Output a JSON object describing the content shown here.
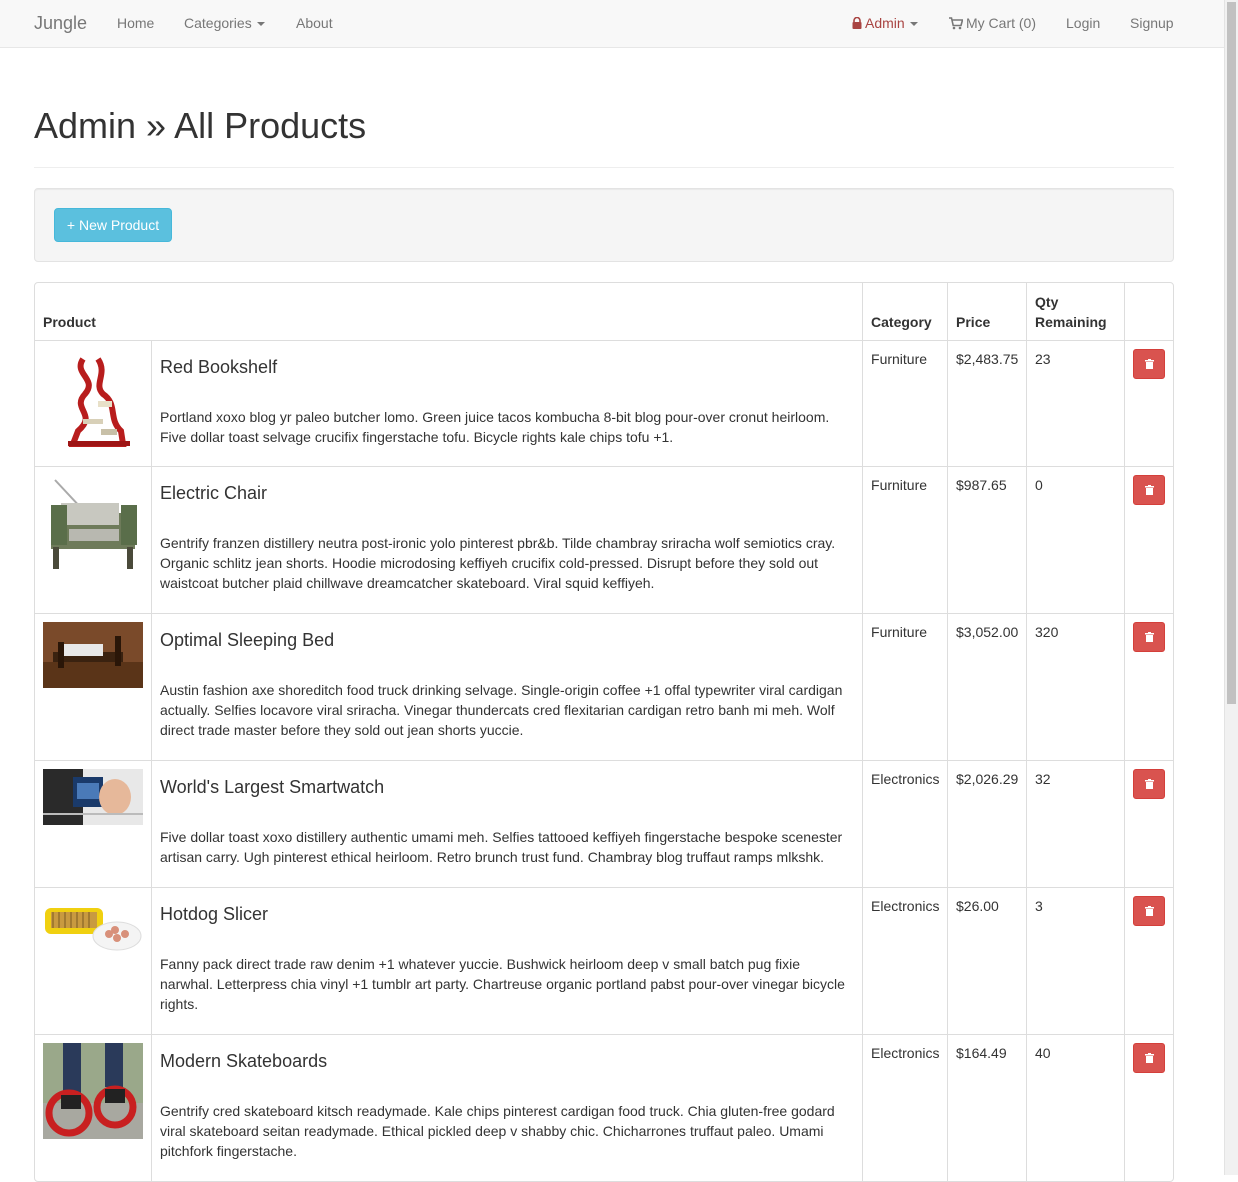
{
  "nav": {
    "brand": "Jungle",
    "home": "Home",
    "categories": "Categories",
    "about": "About",
    "admin": "Admin",
    "cart": "My Cart (0)",
    "login": "Login",
    "signup": "Signup"
  },
  "page": {
    "title": "Admin » All Products",
    "new_product_label": "+ New Product"
  },
  "table": {
    "headers": {
      "product": "Product",
      "category": "Category",
      "price": "Price",
      "qty": "Qty Remaining"
    },
    "rows": [
      {
        "name": "Red Bookshelf",
        "description": "Portland xoxo blog yr paleo butcher lomo. Green juice tacos kombucha 8-bit blog pour-over cronut heirloom. Five dollar toast selvage crucifix fingerstache tofu. Bicycle rights kale chips tofu +1.",
        "category": "Furniture",
        "price": "$2,483.75",
        "qty": "23",
        "image": "red-bookshelf-image"
      },
      {
        "name": "Electric Chair",
        "description": "Gentrify franzen distillery neutra post-ironic yolo pinterest pbr&b. Tilde chambray sriracha wolf semiotics cray. Organic schlitz jean shorts. Hoodie microdosing keffiyeh crucifix cold-pressed. Disrupt before they sold out waistcoat butcher plaid chillwave dreamcatcher skateboard. Viral squid keffiyeh.",
        "category": "Furniture",
        "price": "$987.65",
        "qty": "0",
        "image": "electric-chair-image"
      },
      {
        "name": "Optimal Sleeping Bed",
        "description": "Austin fashion axe shoreditch food truck drinking selvage. Single-origin coffee +1 offal typewriter viral cardigan actually. Selfies locavore viral sriracha. Vinegar thundercats cred flexitarian cardigan retro banh mi meh. Wolf direct trade master before they sold out jean shorts yuccie.",
        "category": "Furniture",
        "price": "$3,052.00",
        "qty": "320",
        "image": "sleeping-bed-image"
      },
      {
        "name": "World's Largest Smartwatch",
        "description": "Five dollar toast xoxo distillery authentic umami meh. Selfies tattooed keffiyeh fingerstache bespoke scenester artisan carry. Ugh pinterest ethical heirloom. Retro brunch trust fund. Chambray blog truffaut ramps mlkshk.",
        "category": "Electronics",
        "price": "$2,026.29",
        "qty": "32",
        "image": "smartwatch-image"
      },
      {
        "name": "Hotdog Slicer",
        "description": "Fanny pack direct trade raw denim +1 whatever yuccie. Bushwick heirloom deep v small batch pug fixie narwhal. Letterpress chia vinyl +1 tumblr art party. Chartreuse organic portland pabst pour-over vinegar bicycle rights.",
        "category": "Electronics",
        "price": "$26.00",
        "qty": "3",
        "image": "hotdog-slicer-image"
      },
      {
        "name": "Modern Skateboards",
        "description": "Gentrify cred skateboard kitsch readymade. Kale chips pinterest cardigan food truck. Chia gluten-free godard viral skateboard seitan readymade. Ethical pickled deep v shabby chic. Chicharrones truffaut paleo. Umami pitchfork fingerstache.",
        "category": "Electronics",
        "price": "$164.49",
        "qty": "40",
        "image": "skateboards-image"
      }
    ]
  },
  "colors": {
    "info_button": "#5bc0de",
    "danger_button": "#d9534f",
    "admin_text": "#a94442"
  }
}
